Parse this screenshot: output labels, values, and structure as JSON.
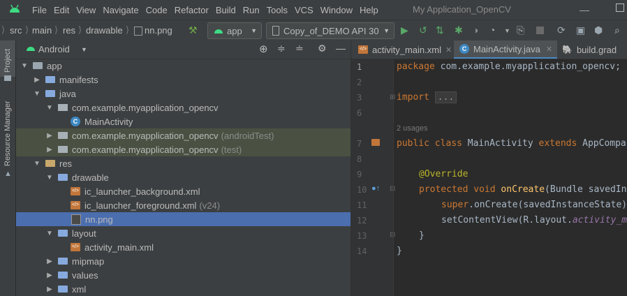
{
  "menubar": {
    "items": [
      "File",
      "Edit",
      "View",
      "Navigate",
      "Code",
      "Refactor",
      "Build",
      "Run",
      "Tools",
      "VCS",
      "Window",
      "Help"
    ],
    "window_title": "My Application_OpenCV"
  },
  "toolbar": {
    "breadcrumbs": [
      "src",
      "main",
      "res",
      "drawable",
      "nn.png"
    ],
    "module_combo": "app",
    "device_combo": "Copy_of_DEMO API 30"
  },
  "side_tabs": {
    "project": "Project",
    "resource_manager": "Resource Manager"
  },
  "project_panel": {
    "view_mode": "Android",
    "tree": [
      {
        "label": "app",
        "suffix": ""
      },
      {
        "label": "manifests",
        "suffix": ""
      },
      {
        "label": "java",
        "suffix": ""
      },
      {
        "label": "com.example.myapplication_opencv",
        "suffix": ""
      },
      {
        "label": "MainActivity",
        "suffix": ""
      },
      {
        "label": "com.example.myapplication_opencv",
        "suffix": "(androidTest)"
      },
      {
        "label": "com.example.myapplication_opencv",
        "suffix": "(test)"
      },
      {
        "label": "res",
        "suffix": ""
      },
      {
        "label": "drawable",
        "suffix": ""
      },
      {
        "label": "ic_launcher_background.xml",
        "suffix": ""
      },
      {
        "label": "ic_launcher_foreground.xml",
        "suffix": "(v24)"
      },
      {
        "label": "nn.png",
        "suffix": ""
      },
      {
        "label": "layout",
        "suffix": ""
      },
      {
        "label": "activity_main.xml",
        "suffix": ""
      },
      {
        "label": "mipmap",
        "suffix": ""
      },
      {
        "label": "values",
        "suffix": ""
      },
      {
        "label": "xml",
        "suffix": ""
      }
    ]
  },
  "editor": {
    "tabs": [
      "activity_main.xml",
      "MainActivity.java",
      "build.grad"
    ],
    "line_numbers": [
      "1",
      "2",
      "3",
      "6",
      "7",
      "8",
      "9",
      "10",
      "11",
      "12",
      "13",
      "14"
    ],
    "usages_hint": "2 usages",
    "code": {
      "l1_kw": "package",
      "l1_rest": " com.example.myapplication_opencv;",
      "l3_kw": "import",
      "l3_fold": "...",
      "l7_kw1": "public",
      "l7_kw2": "class",
      "l7_name": " MainActivity ",
      "l7_kw3": "extends",
      "l7_rest": " AppCompa",
      "l9_ann": "@Override",
      "l10_kw1": "protected",
      "l10_kw2": "void",
      "l10_fn": "onCreate",
      "l10_rest": "(Bundle savedIn",
      "l11_kw": "super",
      "l11_rest": ".onCreate(savedInstanceState)",
      "l12_rest": "setContentView(R.layout.",
      "l12_it": "activity_m",
      "l13": "}",
      "l14": "}"
    }
  }
}
